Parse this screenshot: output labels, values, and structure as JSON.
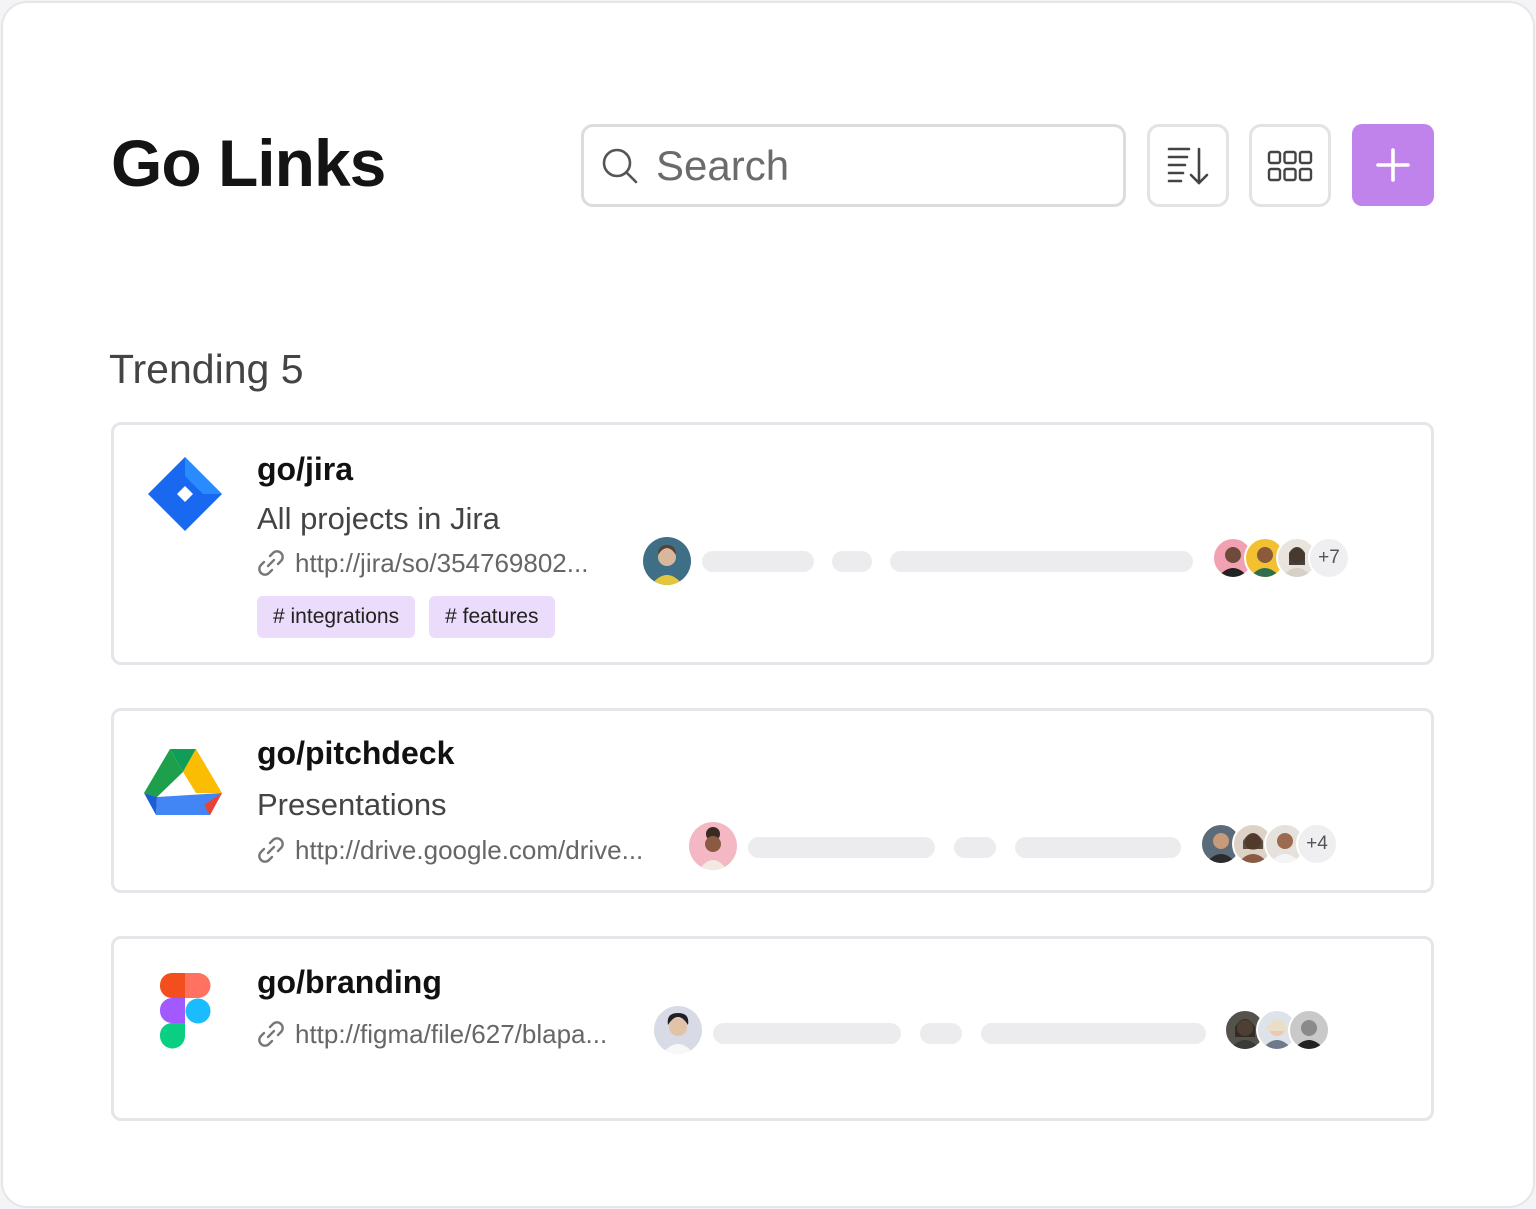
{
  "header": {
    "title": "Go Links",
    "search_placeholder": "Search"
  },
  "section": {
    "title": "Trending 5"
  },
  "colors": {
    "accent": "#c083ec",
    "tag_background": "#ecdcfb"
  },
  "links": [
    {
      "name": "go/jira",
      "description": "All projects in Jira",
      "url": "http://jira/so/354769802...",
      "tags": [
        "# integrations",
        "# features"
      ],
      "extra_collaborators": "+7",
      "logo": "jira-logo"
    },
    {
      "name": "go/pitchdeck",
      "description": "Presentations",
      "url": "http://drive.google.com/drive...",
      "tags": [],
      "extra_collaborators": "+4",
      "logo": "google-drive-logo"
    },
    {
      "name": "go/branding",
      "description": "",
      "url": "http://figma/file/627/blapa...",
      "tags": [],
      "extra_collaborators": "",
      "logo": "figma-logo"
    }
  ],
  "icons": {
    "search": "search-icon",
    "sort": "sort-icon",
    "grid": "grid-view-icon",
    "add": "plus-icon",
    "link": "link-icon"
  }
}
